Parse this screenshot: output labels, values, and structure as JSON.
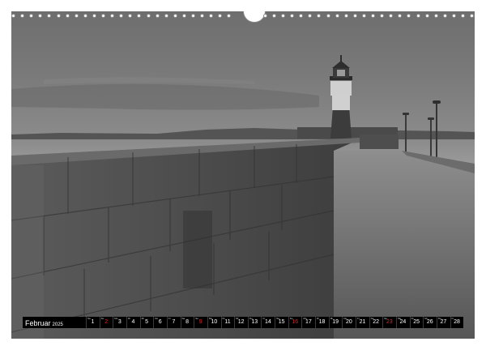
{
  "calendar": {
    "month": "Februar",
    "year": "2025",
    "sunday_color": "#d62828",
    "days": [
      {
        "weekday": "Sa",
        "num": "1",
        "sunday": false
      },
      {
        "weekday": "So",
        "num": "2",
        "sunday": true
      },
      {
        "weekday": "Mo",
        "num": "3",
        "sunday": false
      },
      {
        "weekday": "Di",
        "num": "4",
        "sunday": false
      },
      {
        "weekday": "Mi",
        "num": "5",
        "sunday": false
      },
      {
        "weekday": "Do",
        "num": "6",
        "sunday": false
      },
      {
        "weekday": "Fr",
        "num": "7",
        "sunday": false
      },
      {
        "weekday": "Sa",
        "num": "8",
        "sunday": false
      },
      {
        "weekday": "So",
        "num": "9",
        "sunday": true
      },
      {
        "weekday": "Mo",
        "num": "10",
        "sunday": false
      },
      {
        "weekday": "Di",
        "num": "11",
        "sunday": false
      },
      {
        "weekday": "Mi",
        "num": "12",
        "sunday": false
      },
      {
        "weekday": "Do",
        "num": "13",
        "sunday": false
      },
      {
        "weekday": "Fr",
        "num": "14",
        "sunday": false
      },
      {
        "weekday": "Sa",
        "num": "15",
        "sunday": false
      },
      {
        "weekday": "So",
        "num": "16",
        "sunday": true
      },
      {
        "weekday": "Mo",
        "num": "17",
        "sunday": false
      },
      {
        "weekday": "Di",
        "num": "18",
        "sunday": false
      },
      {
        "weekday": "Mi",
        "num": "19",
        "sunday": false
      },
      {
        "weekday": "Do",
        "num": "20",
        "sunday": false
      },
      {
        "weekday": "Fr",
        "num": "21",
        "sunday": false
      },
      {
        "weekday": "Sa",
        "num": "22",
        "sunday": false
      },
      {
        "weekday": "So",
        "num": "23",
        "sunday": true
      },
      {
        "weekday": "Mo",
        "num": "24",
        "sunday": false
      },
      {
        "weekday": "Di",
        "num": "25",
        "sunday": false
      },
      {
        "weekday": "Mi",
        "num": "26",
        "sunday": false
      },
      {
        "weekday": "Do",
        "num": "27",
        "sunday": false
      },
      {
        "weekday": "Fr",
        "num": "28",
        "sunday": false
      }
    ]
  }
}
